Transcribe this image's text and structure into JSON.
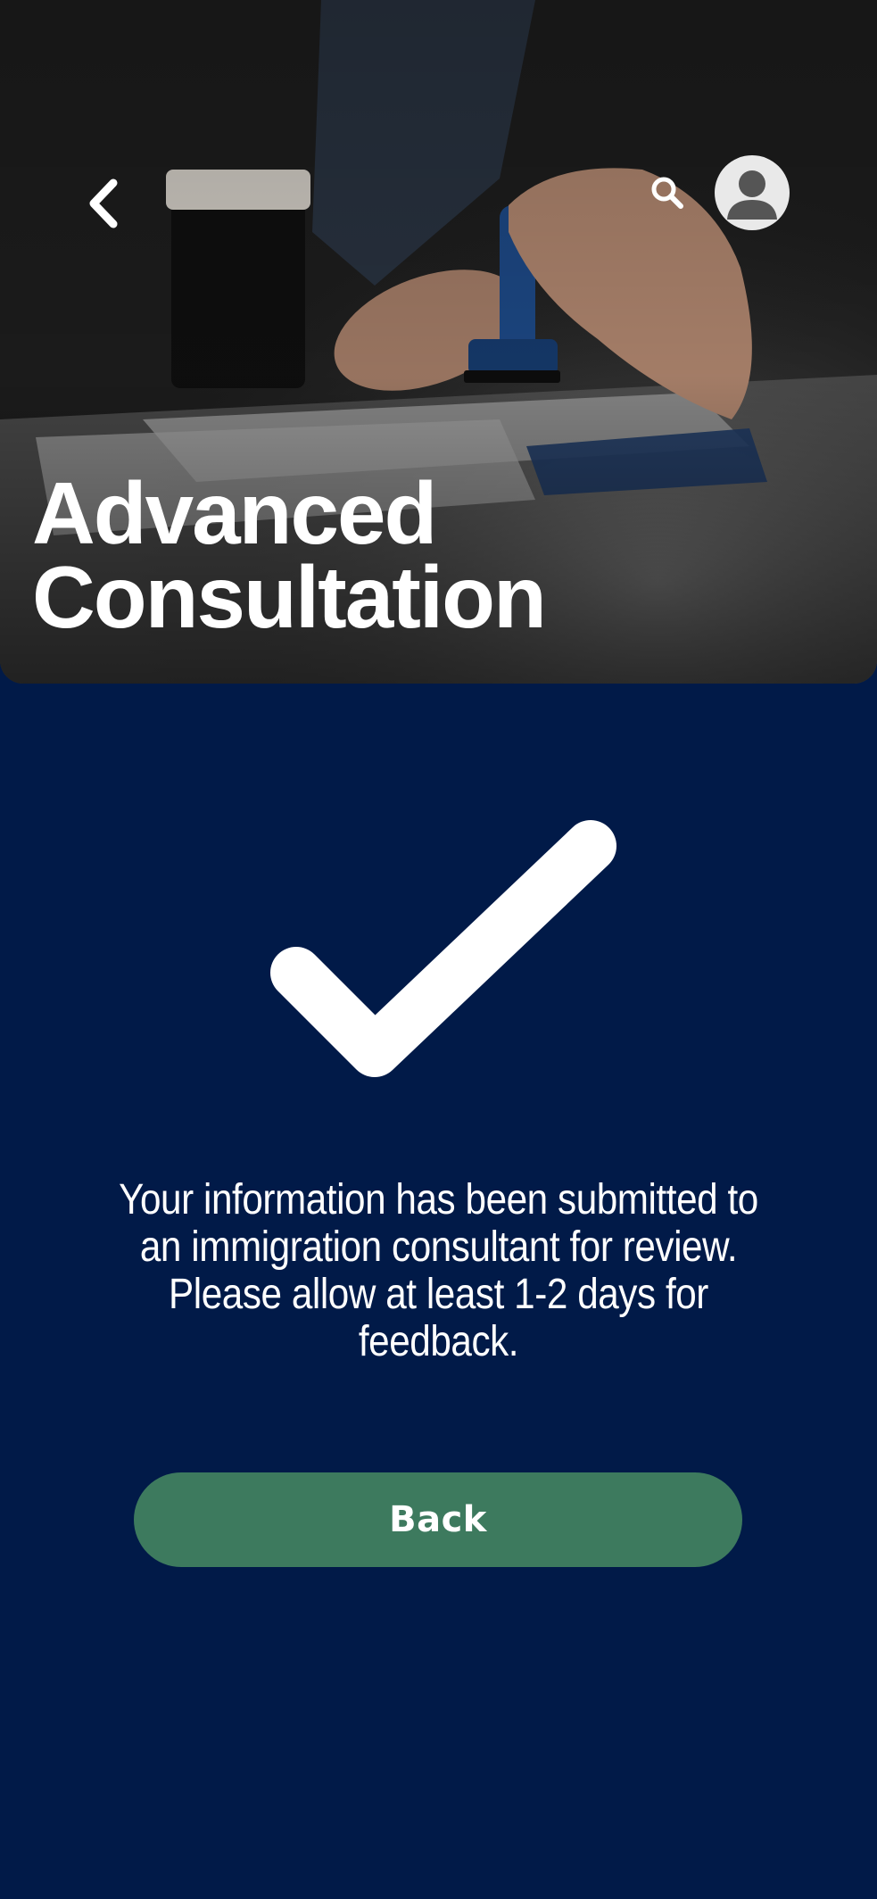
{
  "header": {
    "title_line1": "Advanced",
    "title_line2": "Consultation",
    "back_icon": "chevron-left-icon",
    "search_icon": "search-icon",
    "avatar_icon": "user-avatar-icon"
  },
  "confirmation": {
    "icon": "checkmark-icon",
    "message": "Your information has been submitted to an immigration consultant for review. Please allow at least 1-2 days for feedback."
  },
  "actions": {
    "back_label": "Back"
  },
  "colors": {
    "background": "#011a48",
    "button": "#3d7a5e",
    "text": "#ffffff"
  }
}
